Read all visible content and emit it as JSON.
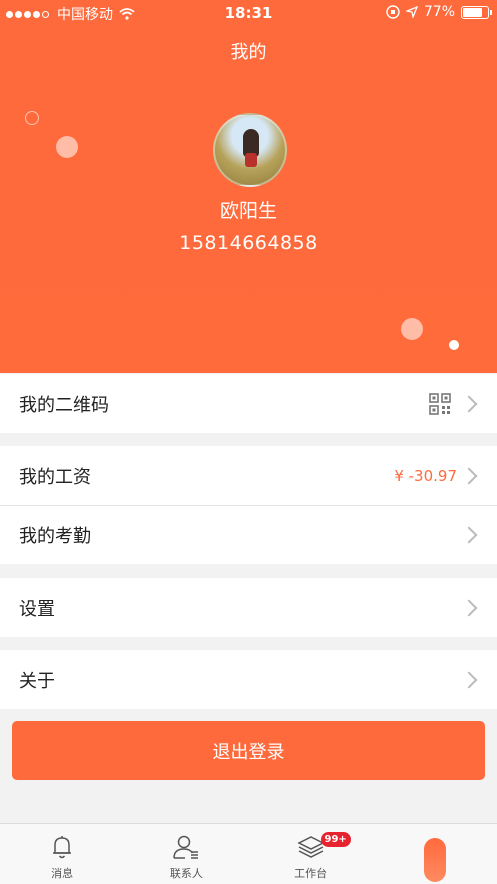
{
  "status_bar": {
    "carrier": "中国移动",
    "time": "18:31",
    "battery": "77%"
  },
  "header": {
    "title": "我的",
    "username": "欧阳生",
    "phone": "15814664858"
  },
  "menu": {
    "qrcode_label": "我的二维码",
    "salary_label": "我的工资",
    "salary_value": "¥ -30.97",
    "attendance_label": "我的考勤",
    "settings_label": "设置",
    "about_label": "关于"
  },
  "logout_label": "退出登录",
  "tabbar": {
    "messages": "消息",
    "contacts": "联系人",
    "workbench": "工作台",
    "workbench_badge": "99+"
  },
  "colors": {
    "accent": "#ff6a3d",
    "badge": "#e6232f"
  }
}
